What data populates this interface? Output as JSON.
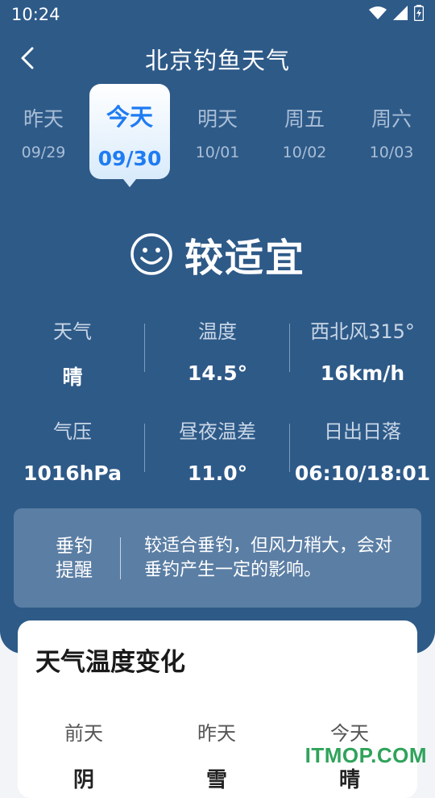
{
  "status_bar": {
    "time": "10:24"
  },
  "header": {
    "title": "北京钓鱼天气"
  },
  "days": [
    {
      "name": "昨天",
      "date": "09/29"
    },
    {
      "name": "今天",
      "date": "09/30"
    },
    {
      "name": "明天",
      "date": "10/01"
    },
    {
      "name": "周五",
      "date": "10/02"
    },
    {
      "name": "周六",
      "date": "10/03"
    }
  ],
  "rating": {
    "label": "较适宜",
    "icon": "smile-icon"
  },
  "stats": [
    {
      "key": "天气",
      "value": "晴"
    },
    {
      "key": "温度",
      "value": "14.5°"
    },
    {
      "key": "西北风315°",
      "value": "16km/h"
    },
    {
      "key": "气压",
      "value": "1016hPa"
    },
    {
      "key": "昼夜温差",
      "value": "11.0°"
    },
    {
      "key": "日出日落",
      "value": "06:10/18:01"
    }
  ],
  "tip": {
    "label_line1": "垂钓",
    "label_line2": "提醒",
    "text": "较适合垂钓，但风力稍大，会对垂钓产生一定的影响。"
  },
  "temp_card": {
    "title": "天气温度变化",
    "columns": [
      {
        "day": "前天",
        "weather": "阴"
      },
      {
        "day": "昨天",
        "weather": "雪"
      },
      {
        "day": "今天",
        "weather": "晴"
      }
    ]
  },
  "watermark": "ITMOP.COM",
  "colors": {
    "primary_bg": "#2e5a88",
    "active_tab": "#1f7cf2",
    "watermark": "#2fa35a"
  }
}
